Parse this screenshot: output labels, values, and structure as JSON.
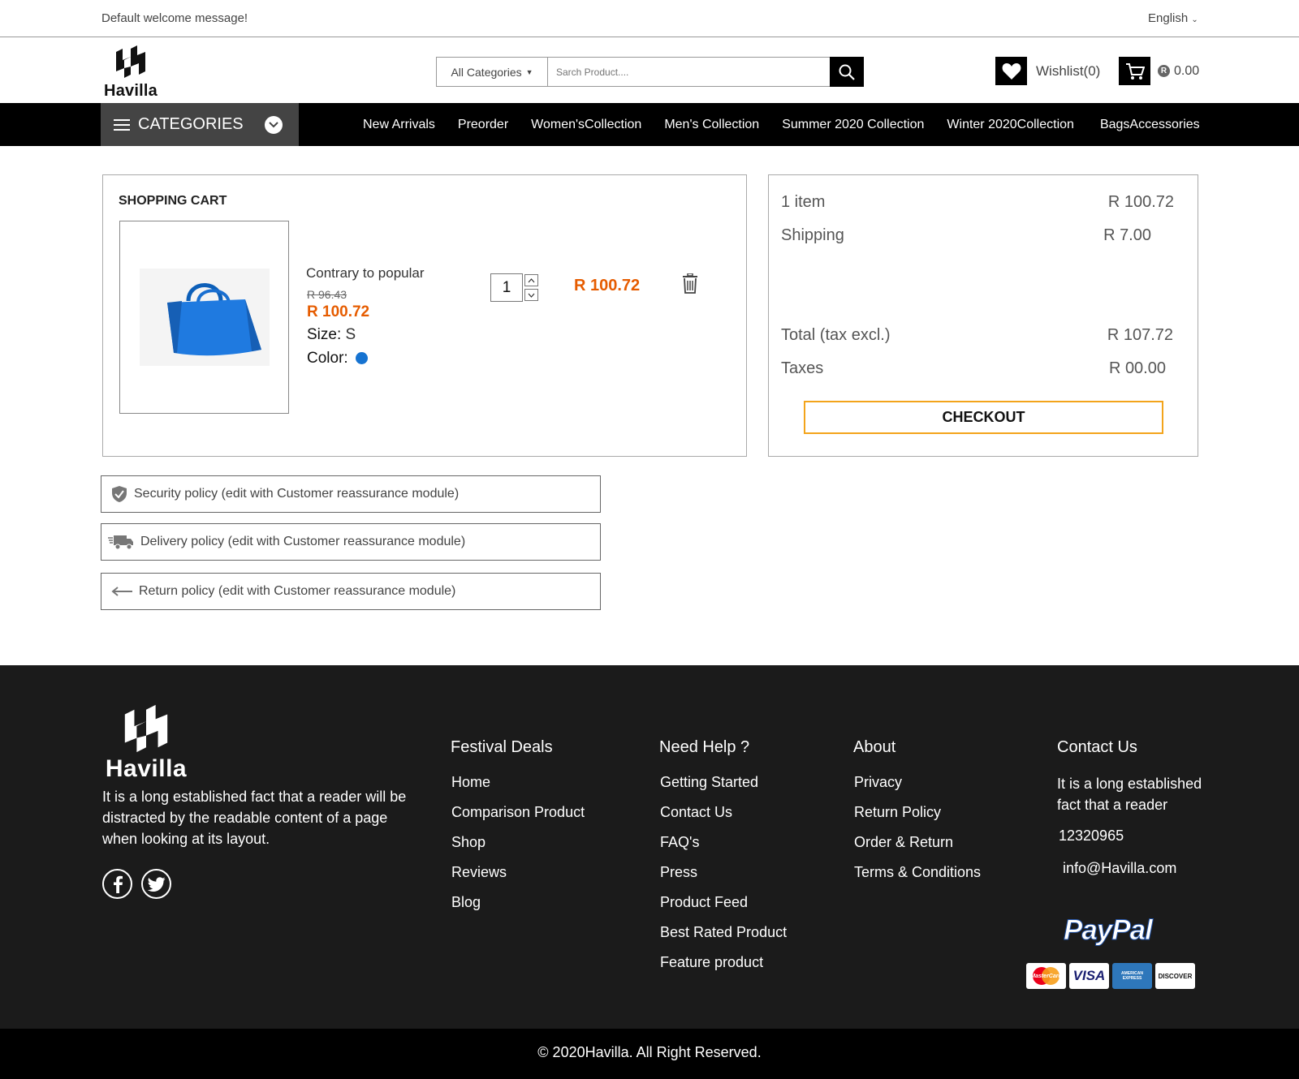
{
  "topbar": {
    "welcome": "Default welcome message!",
    "language": "English"
  },
  "header": {
    "logo_text": "Havilla",
    "search_category": "All Categories",
    "search_placeholder": "Sarch Product....",
    "wishlist_label": "Wishlist(0)",
    "cart_currency_icon": "R",
    "cart_total": "0.00"
  },
  "nav": {
    "categories_label": "CATEGORIES",
    "links": [
      "New Arrivals",
      "Preorder",
      "Women'sCollection",
      "Men's Collection",
      "Summer 2020 Collection",
      "Winter 2020Collection",
      "BagsAccessories"
    ]
  },
  "cart": {
    "title": "SHOPPING CART",
    "item": {
      "name": "Contrary to popular",
      "old_price": "R 96.43",
      "price": "R 100.72",
      "size_label": "Size:",
      "size_value": "S",
      "color_label": "Color:",
      "color_hex": "#1673d1",
      "quantity": "1",
      "line_total": "R 100.72"
    }
  },
  "summary": {
    "items_label": "1 item",
    "items_value": "R 100.72",
    "shipping_label": "Shipping",
    "shipping_value": "R 7.00",
    "total_label": "Total (tax excl.)",
    "total_value": "R 107.72",
    "taxes_label": "Taxes",
    "taxes_value": "R 00.00",
    "checkout_label": "CHECKOUT"
  },
  "policies": [
    {
      "icon": "shield-icon",
      "text": "Security policy (edit with Customer reassurance module)"
    },
    {
      "icon": "truck-icon",
      "text": "Delivery policy (edit with Customer reassurance module)"
    },
    {
      "icon": "arrow-left-icon",
      "text": "Return policy (edit with Customer reassurance module)"
    }
  ],
  "footer": {
    "logo_text": "Havilla",
    "about": "It is a long established fact that a reader will be distracted by the readable content of a page when looking at its layout.",
    "columns": [
      {
        "heading": "Festival Deals",
        "links": [
          "Home",
          "Comparison Product",
          "Shop",
          "Reviews",
          "Blog"
        ]
      },
      {
        "heading": "Need Help ?",
        "links": [
          "Getting Started",
          "Contact Us",
          "FAQ's",
          "Press",
          "Product Feed",
          "Best Rated Product",
          "Feature product"
        ]
      },
      {
        "heading": "About",
        "links": [
          "Privacy",
          "Return Policy",
          "Order & Return",
          "Terms & Conditions"
        ]
      }
    ],
    "contact": {
      "heading": "Contact Us",
      "text": "It is a long established fact that a reader",
      "phone": "12320965",
      "email": "info@Havilla.com"
    },
    "paypal": "PayPal",
    "cards": [
      "MasterCard",
      "VISA",
      "AMERICAN EXPRESS",
      "DISCOVER"
    ],
    "copyright": "© 2020Havilla. All Right Reserved."
  },
  "colors": {
    "accent_price": "#e65c00",
    "checkout_border": "#f3a41b",
    "nav_bg": "#000000",
    "footer_bg": "#1b1b1b"
  }
}
